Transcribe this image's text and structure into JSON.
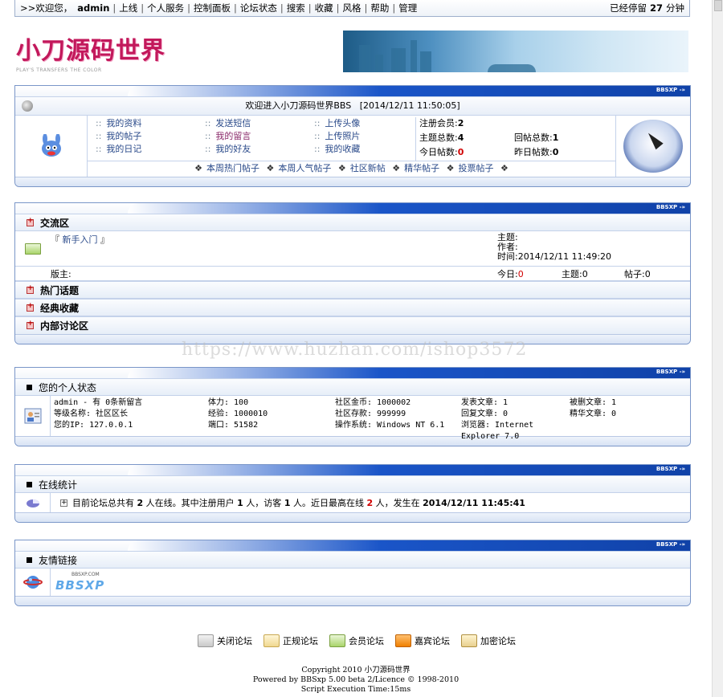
{
  "nav": {
    "welcome": ">>欢迎您，",
    "user": "admin",
    "items": [
      "上线",
      "个人服务",
      "控制面板",
      "论坛状态",
      "搜索",
      "收藏",
      "风格",
      "帮助",
      "管理"
    ],
    "stay_prefix": "已经停留",
    "stay_minutes": "27",
    "stay_suffix": "分钟"
  },
  "logo": {
    "title": "小刀源码世界",
    "subtitle": "PLAY'S TRANSFERS THE COLOR"
  },
  "panel_tag": "BBSXP -»",
  "welcome": {
    "title": "欢迎进入小刀源码世界BBS",
    "time": "[2014/12/11 11:50:05]",
    "links": [
      [
        "我的资料",
        "我的帖子",
        "我的日记"
      ],
      [
        "发送短信",
        "我的留言",
        "我的好友"
      ],
      [
        "上传头像",
        "上传照片",
        "我的收藏"
      ]
    ],
    "link_marker": "::",
    "stats": {
      "members_label": "注册会员:",
      "members": "2",
      "topics_label": "主题总数:",
      "topics": "4",
      "replies_label": "回帖总数:",
      "replies": "1",
      "today_label": "今日帖数:",
      "today": "0",
      "yesterday_label": "昨日帖数:",
      "yesterday": "0"
    },
    "hot_links": [
      "本周热门帖子",
      "本周人气帖子",
      "社区新帖",
      "精华帖子",
      "投票帖子"
    ]
  },
  "forums": {
    "category": "交流区",
    "board_name": "新手入门",
    "board_bracket_l": "『",
    "board_bracket_r": "』",
    "topic_label": "主题:",
    "author_label": "作者:",
    "time_label": "时间:",
    "time": "2014/12/11 11:49:20",
    "moderator_label": "版主:",
    "today_label": "今日:",
    "today": "0",
    "topics_label": "主题:",
    "topics": "0",
    "posts_label": "帖子:",
    "posts": "0",
    "other_categories": [
      "热门话题",
      "经典收藏",
      "内部讨论区"
    ]
  },
  "watermark": "https://www.huzhan.com/ishop3572",
  "status": {
    "title": "您的个人状态",
    "c1": [
      "admin - 有 0条新留言",
      "等级名称: 社区区长",
      "您的IP: 127.0.0.1"
    ],
    "c2": [
      "体力: 100",
      "经验: 1000010",
      "端口: 51582"
    ],
    "c3": [
      "社区金币: 1000002",
      "社区存款: 999999",
      "操作系统: Windows NT 6.1"
    ],
    "c4": [
      "发表文章: 1",
      "回复文章: 0",
      "浏览器: Internet Explorer 7.0"
    ],
    "c5": [
      "被删文章: 1",
      "精华文章: 0"
    ]
  },
  "online": {
    "title": "在线统计",
    "t1": "目前论坛总共有",
    "total": "2",
    "t2": "人在线。其中注册用户",
    "registered": "1",
    "t3": "人，访客",
    "guests": "1",
    "t4": "人。近日最高在线",
    "peak": "2",
    "t5": "人，发生在",
    "peak_time": "2014/12/11 11:45:41"
  },
  "friends": {
    "title": "友情链接",
    "logo_top": "BBSXP.COM",
    "logo_text": "BBSXP"
  },
  "legend": [
    "关闭论坛",
    "正规论坛",
    "会员论坛",
    "嘉宾论坛",
    "加密论坛"
  ],
  "footer": {
    "l1": "Copyright 2010 小刀源码世界",
    "l2": "Powered by BBSxp 5.00 beta 2/Licence © 1998-2010",
    "l3": "Script Execution Time:15ms"
  },
  "colors": {
    "accent": "#1a55c8",
    "border": "#7a96c8",
    "link": "#2a4a8a",
    "alert": "#d00000"
  }
}
